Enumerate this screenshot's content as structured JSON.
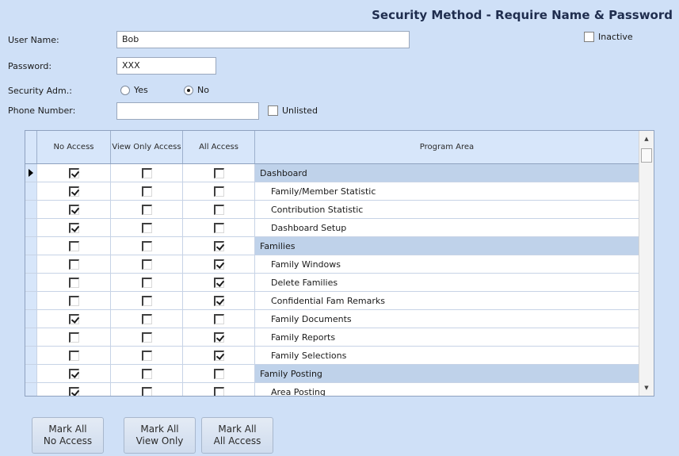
{
  "header": {
    "title": "Security Method - Require Name & Password"
  },
  "form": {
    "user_name_label": "User Name:",
    "user_name_value": "Bob",
    "password_label": "Password:",
    "password_value": "XXX",
    "security_adm_label": "Security Adm.:",
    "yes_label": "Yes",
    "no_label": "No",
    "security_adm_selected": "No",
    "phone_label": "Phone Number:",
    "phone_value": "",
    "unlisted_label": "Unlisted",
    "unlisted_checked": false,
    "inactive_label": "Inactive",
    "inactive_checked": false
  },
  "grid": {
    "columns": {
      "no_access": "No Access",
      "view_only": "View Only Access",
      "all_access": "All Access",
      "program_area": "Program Area"
    },
    "rows": [
      {
        "program_area": "Dashboard",
        "type": "parent",
        "no_access": true,
        "view_only": false,
        "all_access": false,
        "current": true
      },
      {
        "program_area": "Family/Member Statistic",
        "type": "child",
        "no_access": true,
        "view_only": false,
        "all_access": false
      },
      {
        "program_area": "Contribution Statistic",
        "type": "child",
        "no_access": true,
        "view_only": false,
        "all_access": false
      },
      {
        "program_area": "Dashboard Setup",
        "type": "child",
        "no_access": true,
        "view_only": false,
        "all_access": false
      },
      {
        "program_area": "Families",
        "type": "parent",
        "no_access": false,
        "view_only": false,
        "all_access": true
      },
      {
        "program_area": "Family Windows",
        "type": "child",
        "no_access": false,
        "view_only": false,
        "all_access": true
      },
      {
        "program_area": "Delete Families",
        "type": "child",
        "no_access": false,
        "view_only": false,
        "all_access": true
      },
      {
        "program_area": "Confidential Fam Remarks",
        "type": "child",
        "no_access": false,
        "view_only": false,
        "all_access": true
      },
      {
        "program_area": "Family Documents",
        "type": "child",
        "no_access": true,
        "view_only": false,
        "all_access": false
      },
      {
        "program_area": "Family Reports",
        "type": "child",
        "no_access": false,
        "view_only": false,
        "all_access": true
      },
      {
        "program_area": "Family Selections",
        "type": "child",
        "no_access": false,
        "view_only": false,
        "all_access": true
      },
      {
        "program_area": "Family Posting",
        "type": "parent",
        "no_access": true,
        "view_only": false,
        "all_access": false
      },
      {
        "program_area": "Area Posting",
        "type": "child",
        "no_access": true,
        "view_only": false,
        "all_access": false
      }
    ]
  },
  "buttons": {
    "mark_all_no_access": {
      "line1": "Mark All",
      "line2": "No Access"
    },
    "mark_all_view_only": {
      "line1": "Mark All",
      "line2": "View Only"
    },
    "mark_all_all_access": {
      "line1": "Mark All",
      "line2": "All Access"
    }
  }
}
